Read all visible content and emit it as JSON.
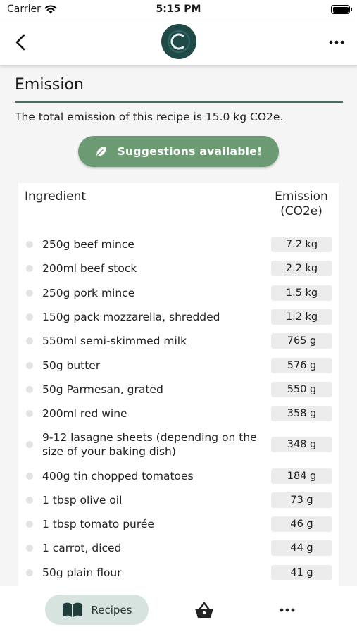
{
  "status_bar": {
    "carrier": "Carrier",
    "time": "5:15 PM"
  },
  "section": {
    "title": "Emission",
    "total_text": "The total emission of this recipe is 15.0 kg CO2e."
  },
  "suggestions_button": {
    "label": "Suggestions available!"
  },
  "table": {
    "header_ingredient": "Ingredient",
    "header_emission_line1": "Emission",
    "header_emission_line2": "(CO2e)",
    "rows": [
      {
        "name": "250g beef mince",
        "emission": "7.2 kg"
      },
      {
        "name": "200ml beef stock",
        "emission": "2.2 kg"
      },
      {
        "name": "250g pork mince",
        "emission": "1.5 kg"
      },
      {
        "name": "150g pack mozzarella, shredded",
        "emission": "1.2 kg"
      },
      {
        "name": "550ml semi-skimmed milk",
        "emission": "765 g"
      },
      {
        "name": "50g butter",
        "emission": "576 g"
      },
      {
        "name": "50g Parmesan, grated",
        "emission": "550 g"
      },
      {
        "name": "200ml red wine",
        "emission": "358 g"
      },
      {
        "name": "9-12 lasagne sheets (depending on the size of your baking dish)",
        "emission": "348 g"
      },
      {
        "name": "400g tin chopped tomatoes",
        "emission": "184 g"
      },
      {
        "name": "1 tbsp olive oil",
        "emission": "73 g"
      },
      {
        "name": "1 tbsp tomato purée",
        "emission": "46 g"
      },
      {
        "name": "1 carrot, diced",
        "emission": "44 g"
      },
      {
        "name": "50g plain flour",
        "emission": "41 g"
      }
    ]
  },
  "tab_bar": {
    "recipes_label": "Recipes"
  },
  "icons": {
    "back": "chevron-left-icon",
    "logo": "app-logo-icon",
    "more": "more-horizontal-icon",
    "leaf": "leaf-icon",
    "book": "book-open-icon",
    "basket": "basket-icon",
    "wifi": "wifi-icon",
    "battery": "battery-icon"
  },
  "colors": {
    "brand_dark": "#1f4a48",
    "suggestion_green": "#6c9a72",
    "tab_active_bg": "#d6e3de",
    "pill_bg": "#ececec"
  }
}
